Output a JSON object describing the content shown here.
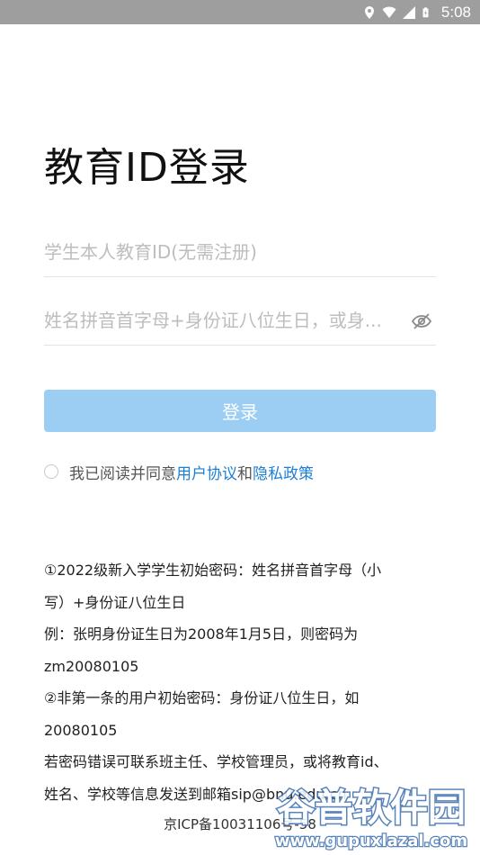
{
  "status_bar": {
    "time": "5:08",
    "icons": [
      "location-icon",
      "wifi-icon",
      "signal-icon",
      "battery-charging-icon"
    ]
  },
  "page": {
    "title": "教育ID登录"
  },
  "form": {
    "id_placeholder": "学生本人教育ID(无需注册)",
    "password_placeholder": "姓名拼音首字母+身份证八位生日，或身...",
    "password_toggle_icon": "eye-off-icon",
    "login_label": "登录",
    "login_color": "#9ccdf3"
  },
  "agreement": {
    "prefix": "我已阅读并同意",
    "user_agreement": "用户协议",
    "and": "和",
    "privacy_policy": "隐私政策",
    "link_color": "#1c7fd6"
  },
  "info": {
    "lines": [
      "①2022级新入学学生初始密码：姓名拼音首字母（小",
      "写）+身份证八位生日",
      "例：张明身份证生日为2008年1月5日，则密码为",
      "zm20080105",
      "②非第一条的用户初始密码：身份证八位生日，如",
      "20080105",
      "若密码错误可联系班主任、学校管理员，或将教育id、",
      "姓名、学校等信息发送到邮箱sip@bnu.edu.cn"
    ]
  },
  "footer": {
    "icp": "京ICP备10031106号-58"
  },
  "watermark": {
    "name": "谷普软件园",
    "url": "www.gupuxlazal.com"
  }
}
